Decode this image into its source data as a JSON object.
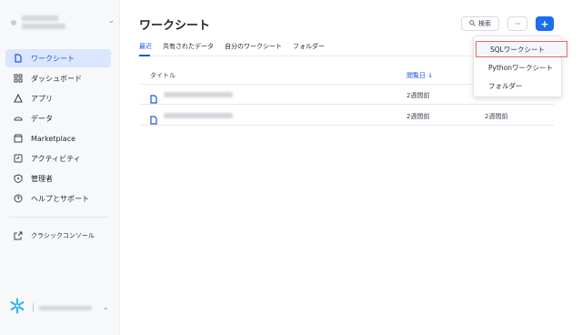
{
  "sidebar": {
    "items": [
      {
        "label": "ワークシート",
        "icon": "worksheet-icon",
        "active": true
      },
      {
        "label": "ダッシュボード",
        "icon": "dashboard-icon"
      },
      {
        "label": "アプリ",
        "icon": "apps-icon"
      },
      {
        "label": "データ",
        "icon": "data-icon"
      },
      {
        "label": "Marketplace",
        "icon": "marketplace-icon"
      },
      {
        "label": "アクティビティ",
        "icon": "activity-icon"
      },
      {
        "label": "管理者",
        "icon": "shield-icon"
      },
      {
        "label": "ヘルプとサポート",
        "icon": "help-icon"
      }
    ],
    "classic": {
      "label": "クラシックコンソール",
      "icon": "external-link-icon"
    }
  },
  "main": {
    "title": "ワークシート",
    "search_label": "検索",
    "more_label": "···",
    "add_label": "+",
    "tabs": [
      {
        "label": "最近",
        "active": true
      },
      {
        "label": "共有されたデータ"
      },
      {
        "label": "自分のワークシート"
      },
      {
        "label": "フォルダー"
      }
    ],
    "table": {
      "headers": {
        "title": "タイトル",
        "viewed": "閲覧日 ↓"
      },
      "rows": [
        {
          "viewed": "2週間前",
          "updated": ""
        },
        {
          "viewed": "2週間前",
          "updated": "2週間前"
        }
      ]
    }
  },
  "dropdown": {
    "items": [
      "SQLワークシート",
      "Pythonワークシート",
      "フォルダー"
    ]
  },
  "colors": {
    "accent": "#1a6cf0",
    "active_bg": "#dbe6ff",
    "highlight": "#e06a5c"
  }
}
